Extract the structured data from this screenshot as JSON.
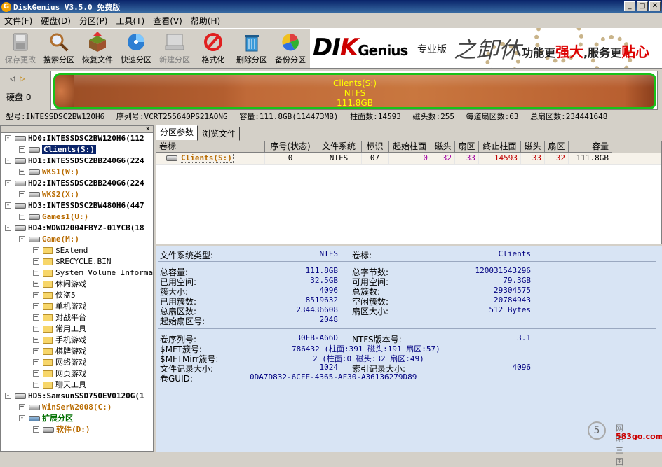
{
  "window": {
    "title": "DiskGenius V3.5.0 免费版",
    "app_icon": "G"
  },
  "menu": [
    "文件(F)",
    "硬盘(D)",
    "分区(P)",
    "工具(T)",
    "查看(V)",
    "帮助(H)"
  ],
  "toolbar": [
    {
      "label": "保存更改",
      "icon": "save-icon",
      "enabled": false
    },
    {
      "label": "搜索分区",
      "icon": "magnifier-icon",
      "enabled": true
    },
    {
      "label": "恢复文件",
      "icon": "recover-box-icon",
      "enabled": true
    },
    {
      "label": "快速分区",
      "icon": "pie-disk-icon",
      "enabled": true
    },
    {
      "label": "新建分区",
      "icon": "new-partition-icon",
      "enabled": false
    },
    {
      "label": "格式化",
      "icon": "format-icon",
      "enabled": true
    },
    {
      "label": "删除分区",
      "icon": "trash-icon",
      "enabled": true
    },
    {
      "label": "备份分区",
      "icon": "backup-icon",
      "enabled": true
    }
  ],
  "banner": {
    "logo_a": "DI",
    "logo_b": "K",
    "logo_c": "Genius",
    "edition": "专业版",
    "calligraphy": "之卸休",
    "slogan_a": "功能更",
    "slogan_b": "强大",
    "slogan_c": ",服务更",
    "slogan_d": "贴心"
  },
  "disk": {
    "label": "硬盘 0",
    "partition_name": "Clients(S:)",
    "partition_fs": "NTFS",
    "partition_size": "111.8GB",
    "info": [
      "型号:INTESSDSC2BW120H6",
      "序列号:VCRT255640PS21AONG",
      "容量:111.8GB(114473MB)",
      "柱面数:14593",
      "磁头数:255",
      "每道扇区数:63",
      "总扇区数:234441648"
    ]
  },
  "tree": [
    {
      "text": "HD0:INTESSDSC2BW120H6(112",
      "level": 0,
      "type": "disk",
      "pm": "-"
    },
    {
      "text": "Clients(S:)",
      "level": 1,
      "type": "part",
      "pm": "+",
      "selected": true
    },
    {
      "text": "HD1:INTESSDSC2BB240G6(224",
      "level": 0,
      "type": "disk",
      "pm": "-"
    },
    {
      "text": "WKS1(W:)",
      "level": 1,
      "type": "part",
      "pm": "+"
    },
    {
      "text": "HD2:INTESSDSC2BB240G6(224",
      "level": 0,
      "type": "disk",
      "pm": "-"
    },
    {
      "text": "WKS2(X:)",
      "level": 1,
      "type": "part",
      "pm": "+"
    },
    {
      "text": "HD3:INTESSDSC2BW480H6(447",
      "level": 0,
      "type": "disk",
      "pm": "-"
    },
    {
      "text": "Games1(U:)",
      "level": 1,
      "type": "part",
      "pm": "+"
    },
    {
      "text": "HD4:WDWD2004FBYZ-01YCB(18",
      "level": 0,
      "type": "disk",
      "pm": "-"
    },
    {
      "text": "Game(M:)",
      "level": 1,
      "type": "part",
      "pm": "-"
    },
    {
      "text": "$Extend",
      "level": 2,
      "type": "folder",
      "pm": "+"
    },
    {
      "text": "$RECYCLE.BIN",
      "level": 2,
      "type": "folder",
      "pm": "+"
    },
    {
      "text": "System Volume Informati",
      "level": 2,
      "type": "folder",
      "pm": "+"
    },
    {
      "text": "休闲游戏",
      "level": 2,
      "type": "folder",
      "pm": "+"
    },
    {
      "text": "侠盗5",
      "level": 2,
      "type": "folder",
      "pm": "+"
    },
    {
      "text": "单机游戏",
      "level": 2,
      "type": "folder",
      "pm": "+"
    },
    {
      "text": "对战平台",
      "level": 2,
      "type": "folder",
      "pm": "+"
    },
    {
      "text": "常用工具",
      "level": 2,
      "type": "folder",
      "pm": "+"
    },
    {
      "text": "手机游戏",
      "level": 2,
      "type": "folder",
      "pm": "+"
    },
    {
      "text": "棋牌游戏",
      "level": 2,
      "type": "folder",
      "pm": "+"
    },
    {
      "text": "网络游戏",
      "level": 2,
      "type": "folder",
      "pm": "+"
    },
    {
      "text": "网页游戏",
      "level": 2,
      "type": "folder",
      "pm": "+"
    },
    {
      "text": "聊天工具",
      "level": 2,
      "type": "folder",
      "pm": "+"
    },
    {
      "text": "HD5:SamsunSSD750EV0120G(1",
      "level": 0,
      "type": "disk",
      "pm": "-"
    },
    {
      "text": "WinSerW2008(C:)",
      "level": 1,
      "type": "part",
      "pm": "+"
    },
    {
      "text": "扩展分区",
      "level": 1,
      "type": "ext",
      "pm": "-"
    },
    {
      "text": "软件(D:)",
      "level": 2,
      "type": "part",
      "pm": "+"
    }
  ],
  "tabs": [
    "分区参数",
    "浏览文件"
  ],
  "columns": [
    "卷标",
    "序号(状态)",
    "文件系统",
    "标识",
    "起始柱面",
    "磁头",
    "扇区",
    "终止柱面",
    "磁头",
    "扇区",
    "容量"
  ],
  "rows": [
    [
      "Clients(S:)",
      "0",
      "NTFS",
      "07",
      "0",
      "32",
      "33",
      "14593",
      "33",
      "32",
      "111.8GB"
    ]
  ],
  "props": {
    "fs_type_label": "文件系统类型:",
    "fs_type": "NTFS",
    "vol_label_label": "卷标:",
    "vol_label": "Clients",
    "total_label": "总容量:",
    "total": "111.8GB",
    "total_bytes_label": "总字节数:",
    "total_bytes": "120031543296",
    "used_label": "已用空间:",
    "used": "32.5GB",
    "free_label": "可用空间:",
    "free": "79.3GB",
    "cluster_label": "簇大小:",
    "cluster": "4096",
    "total_clusters_label": "总簇数:",
    "total_clusters": "29304575",
    "used_clusters_label": "已用簇数:",
    "used_clusters": "8519632",
    "free_clusters_label": "空闲簇数:",
    "free_clusters": "20784943",
    "total_sectors_label": "总扇区数:",
    "total_sectors": "234436608",
    "sector_size_label": "扇区大小:",
    "sector_size": "512 Bytes",
    "start_sector_label": "起始扇区号:",
    "start_sector": "2048",
    "serial_label": "卷序列号:",
    "serial": "30FB-A66D",
    "ntfs_ver_label": "NTFS版本号:",
    "ntfs_ver": "3.1",
    "mft_label": "$MFT簇号:",
    "mft": "786432 (柱面:391 磁头:191 扇区:57)",
    "mftmirr_label": "$MFTMirr簇号:",
    "mftmirr": "2 (柱面:0 磁头:32 扇区:49)",
    "record_label": "文件记录大小:",
    "record": "1024",
    "index_label": "索引记录大小:",
    "index": "4096",
    "guid_label": "卷GUID:",
    "guid": "0DA7D832-6CFE-4365-AF30-A36136279D89"
  },
  "watermark": {
    "ring": "5",
    "site_name": "网吧三国",
    "site_url": "583go.com"
  }
}
